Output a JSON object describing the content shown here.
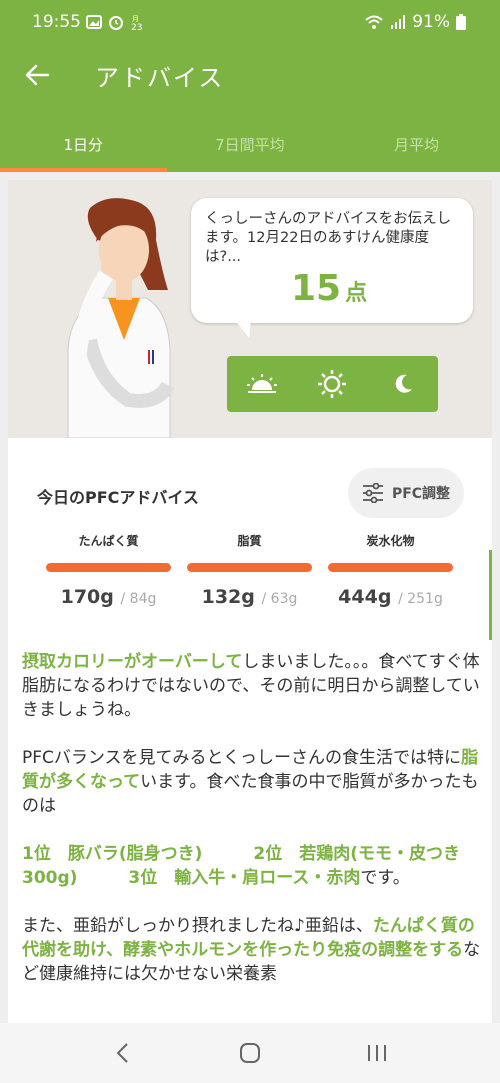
{
  "status": {
    "time": "19:55",
    "battery": "91%"
  },
  "appbar": {
    "title": "アドバイス"
  },
  "tabs": [
    {
      "label": "1日分",
      "active": true
    },
    {
      "label": "7日間平均",
      "active": false
    },
    {
      "label": "月平均",
      "active": false
    }
  ],
  "advice_header": {
    "message": "くっしーさんのアドバイスをお伝えします。12月22日のあすけん健康度は?...",
    "score": "15",
    "score_unit": "点"
  },
  "time_buttons": [
    "morning-icon",
    "noon-icon",
    "night-icon"
  ],
  "pfc": {
    "title": "今日のPFCアドバイス",
    "adjust_label": "PFC調整",
    "items": [
      {
        "label": "たんぱく質",
        "value": "170",
        "unit": "g",
        "target": "/ 84g"
      },
      {
        "label": "脂質",
        "value": "132",
        "unit": "g",
        "target": "/ 63g"
      },
      {
        "label": "炭水化物",
        "value": "444",
        "unit": "g",
        "target": "/ 251g"
      }
    ]
  },
  "advice": {
    "p1_hl": "摂取カロリーがオーバーして",
    "p1_text": "しまいました。。。食べてすぐ体脂肪になるわけではないので、その前に明日から調整していきましょうね。",
    "p2_text1": "PFCバランスを見てみるとくっしーさんの食生活では特に",
    "p2_hl": "脂質が多くなって",
    "p2_text2": "います。食べた食事の中で脂質が多かったものは",
    "p3_hl": "1位　豚バラ(脂身つき)　　　2位　若鶏肉(モモ・皮つき300g)　　　3位　輸入牛・肩ロース・赤肉",
    "p3_text": "です。",
    "p4_text1": "また、亜鉛がしっかり摂れましたね♪亜鉛は、",
    "p4_hl": "たんぱく質の代謝を助け、酵素やホルモンを作ったり免疫の調整をする",
    "p4_text2": "など健康維持には欠かせない栄養素"
  },
  "colors": {
    "accent": "#7cb342",
    "bar": "#f26b32"
  }
}
